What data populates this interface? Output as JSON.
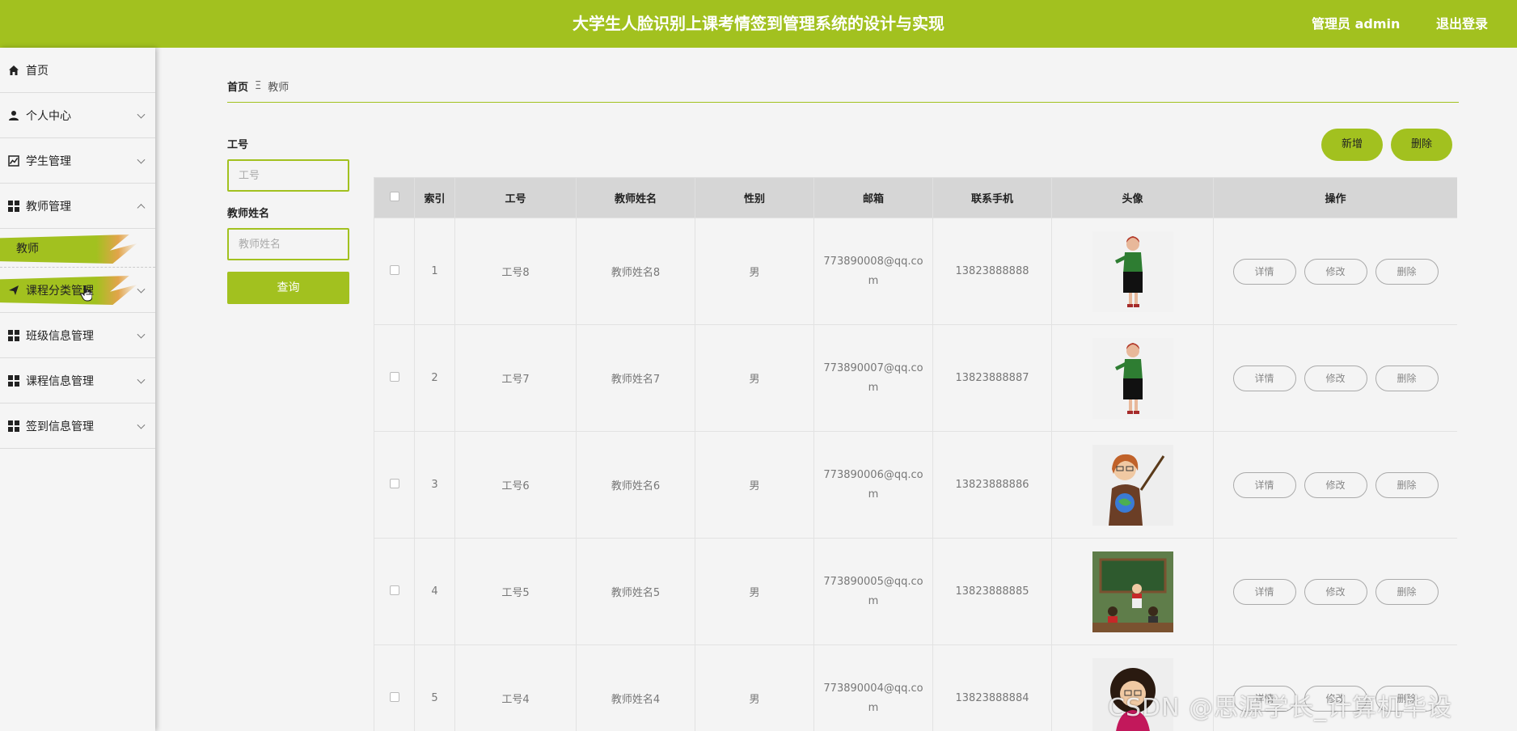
{
  "header": {
    "title": "大学生人脸识别上课考情签到管理系统的设计与实现",
    "admin_label": "管理员 admin",
    "logout_label": "退出登录"
  },
  "sidebar": {
    "items": [
      {
        "label": "首页",
        "icon": "home-icon"
      },
      {
        "label": "个人中心",
        "icon": "user-icon"
      },
      {
        "label": "学生管理",
        "icon": "chart-icon"
      },
      {
        "label": "教师管理",
        "icon": "grid-icon"
      },
      {
        "label": "课程分类管理",
        "icon": "send-icon"
      },
      {
        "label": "班级信息管理",
        "icon": "grid-icon"
      },
      {
        "label": "课程信息管理",
        "icon": "grid-icon"
      },
      {
        "label": "签到信息管理",
        "icon": "grid-icon"
      }
    ],
    "sub_item": "教师"
  },
  "breadcrumb": {
    "home": "首页",
    "separator": "Ξ",
    "current": "教师"
  },
  "search": {
    "field1_label": "工号",
    "field1_placeholder": "工号",
    "field2_label": "教师姓名",
    "field2_placeholder": "教师姓名",
    "button": "查询"
  },
  "actions": {
    "add": "新增",
    "delete": "删除"
  },
  "table": {
    "headers": [
      "索引",
      "工号",
      "教师姓名",
      "性别",
      "邮箱",
      "联系手机",
      "头像",
      "操作"
    ],
    "rows": [
      {
        "index": "1",
        "job_no": "工号8",
        "name": "教师姓名8",
        "gender": "男",
        "email": "773890008@qq.com",
        "phone": "13823888888",
        "avatar": "teacher-red-avatar"
      },
      {
        "index": "2",
        "job_no": "工号7",
        "name": "教师姓名7",
        "gender": "男",
        "email": "773890007@qq.com",
        "phone": "13823888887",
        "avatar": "teacher-red-avatar"
      },
      {
        "index": "3",
        "job_no": "工号6",
        "name": "教师姓名6",
        "gender": "男",
        "email": "773890006@qq.com",
        "phone": "13823888886",
        "avatar": "teacher-globe-avatar"
      },
      {
        "index": "4",
        "job_no": "工号5",
        "name": "教师姓名5",
        "gender": "男",
        "email": "773890005@qq.com",
        "phone": "13823888885",
        "avatar": "classroom-avatar"
      },
      {
        "index": "5",
        "job_no": "工号4",
        "name": "教师姓名4",
        "gender": "男",
        "email": "773890004@qq.com",
        "phone": "13823888884",
        "avatar": "teacher-curly-avatar"
      }
    ],
    "op_labels": {
      "detail": "详情",
      "edit": "修改",
      "delete": "删除"
    }
  },
  "watermark": "CSDN @思源学长_计算机毕设",
  "colors": {
    "accent": "#a2c11f"
  }
}
